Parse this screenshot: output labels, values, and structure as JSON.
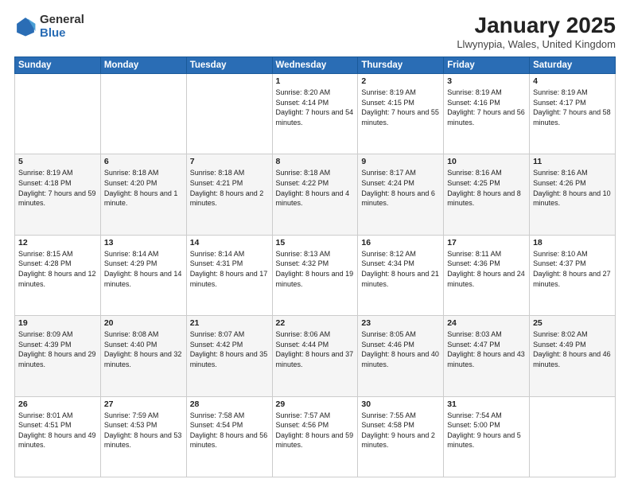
{
  "header": {
    "logo": {
      "general": "General",
      "blue": "Blue"
    },
    "title": "January 2025",
    "subtitle": "Llwynypia, Wales, United Kingdom"
  },
  "days_of_week": [
    "Sunday",
    "Monday",
    "Tuesday",
    "Wednesday",
    "Thursday",
    "Friday",
    "Saturday"
  ],
  "weeks": [
    [
      {
        "day": "",
        "sunrise": "",
        "sunset": "",
        "daylight": ""
      },
      {
        "day": "",
        "sunrise": "",
        "sunset": "",
        "daylight": ""
      },
      {
        "day": "",
        "sunrise": "",
        "sunset": "",
        "daylight": ""
      },
      {
        "day": "1",
        "sunrise": "Sunrise: 8:20 AM",
        "sunset": "Sunset: 4:14 PM",
        "daylight": "Daylight: 7 hours and 54 minutes."
      },
      {
        "day": "2",
        "sunrise": "Sunrise: 8:19 AM",
        "sunset": "Sunset: 4:15 PM",
        "daylight": "Daylight: 7 hours and 55 minutes."
      },
      {
        "day": "3",
        "sunrise": "Sunrise: 8:19 AM",
        "sunset": "Sunset: 4:16 PM",
        "daylight": "Daylight: 7 hours and 56 minutes."
      },
      {
        "day": "4",
        "sunrise": "Sunrise: 8:19 AM",
        "sunset": "Sunset: 4:17 PM",
        "daylight": "Daylight: 7 hours and 58 minutes."
      }
    ],
    [
      {
        "day": "5",
        "sunrise": "Sunrise: 8:19 AM",
        "sunset": "Sunset: 4:18 PM",
        "daylight": "Daylight: 7 hours and 59 minutes."
      },
      {
        "day": "6",
        "sunrise": "Sunrise: 8:18 AM",
        "sunset": "Sunset: 4:20 PM",
        "daylight": "Daylight: 8 hours and 1 minute."
      },
      {
        "day": "7",
        "sunrise": "Sunrise: 8:18 AM",
        "sunset": "Sunset: 4:21 PM",
        "daylight": "Daylight: 8 hours and 2 minutes."
      },
      {
        "day": "8",
        "sunrise": "Sunrise: 8:18 AM",
        "sunset": "Sunset: 4:22 PM",
        "daylight": "Daylight: 8 hours and 4 minutes."
      },
      {
        "day": "9",
        "sunrise": "Sunrise: 8:17 AM",
        "sunset": "Sunset: 4:24 PM",
        "daylight": "Daylight: 8 hours and 6 minutes."
      },
      {
        "day": "10",
        "sunrise": "Sunrise: 8:16 AM",
        "sunset": "Sunset: 4:25 PM",
        "daylight": "Daylight: 8 hours and 8 minutes."
      },
      {
        "day": "11",
        "sunrise": "Sunrise: 8:16 AM",
        "sunset": "Sunset: 4:26 PM",
        "daylight": "Daylight: 8 hours and 10 minutes."
      }
    ],
    [
      {
        "day": "12",
        "sunrise": "Sunrise: 8:15 AM",
        "sunset": "Sunset: 4:28 PM",
        "daylight": "Daylight: 8 hours and 12 minutes."
      },
      {
        "day": "13",
        "sunrise": "Sunrise: 8:14 AM",
        "sunset": "Sunset: 4:29 PM",
        "daylight": "Daylight: 8 hours and 14 minutes."
      },
      {
        "day": "14",
        "sunrise": "Sunrise: 8:14 AM",
        "sunset": "Sunset: 4:31 PM",
        "daylight": "Daylight: 8 hours and 17 minutes."
      },
      {
        "day": "15",
        "sunrise": "Sunrise: 8:13 AM",
        "sunset": "Sunset: 4:32 PM",
        "daylight": "Daylight: 8 hours and 19 minutes."
      },
      {
        "day": "16",
        "sunrise": "Sunrise: 8:12 AM",
        "sunset": "Sunset: 4:34 PM",
        "daylight": "Daylight: 8 hours and 21 minutes."
      },
      {
        "day": "17",
        "sunrise": "Sunrise: 8:11 AM",
        "sunset": "Sunset: 4:36 PM",
        "daylight": "Daylight: 8 hours and 24 minutes."
      },
      {
        "day": "18",
        "sunrise": "Sunrise: 8:10 AM",
        "sunset": "Sunset: 4:37 PM",
        "daylight": "Daylight: 8 hours and 27 minutes."
      }
    ],
    [
      {
        "day": "19",
        "sunrise": "Sunrise: 8:09 AM",
        "sunset": "Sunset: 4:39 PM",
        "daylight": "Daylight: 8 hours and 29 minutes."
      },
      {
        "day": "20",
        "sunrise": "Sunrise: 8:08 AM",
        "sunset": "Sunset: 4:40 PM",
        "daylight": "Daylight: 8 hours and 32 minutes."
      },
      {
        "day": "21",
        "sunrise": "Sunrise: 8:07 AM",
        "sunset": "Sunset: 4:42 PM",
        "daylight": "Daylight: 8 hours and 35 minutes."
      },
      {
        "day": "22",
        "sunrise": "Sunrise: 8:06 AM",
        "sunset": "Sunset: 4:44 PM",
        "daylight": "Daylight: 8 hours and 37 minutes."
      },
      {
        "day": "23",
        "sunrise": "Sunrise: 8:05 AM",
        "sunset": "Sunset: 4:46 PM",
        "daylight": "Daylight: 8 hours and 40 minutes."
      },
      {
        "day": "24",
        "sunrise": "Sunrise: 8:03 AM",
        "sunset": "Sunset: 4:47 PM",
        "daylight": "Daylight: 8 hours and 43 minutes."
      },
      {
        "day": "25",
        "sunrise": "Sunrise: 8:02 AM",
        "sunset": "Sunset: 4:49 PM",
        "daylight": "Daylight: 8 hours and 46 minutes."
      }
    ],
    [
      {
        "day": "26",
        "sunrise": "Sunrise: 8:01 AM",
        "sunset": "Sunset: 4:51 PM",
        "daylight": "Daylight: 8 hours and 49 minutes."
      },
      {
        "day": "27",
        "sunrise": "Sunrise: 7:59 AM",
        "sunset": "Sunset: 4:53 PM",
        "daylight": "Daylight: 8 hours and 53 minutes."
      },
      {
        "day": "28",
        "sunrise": "Sunrise: 7:58 AM",
        "sunset": "Sunset: 4:54 PM",
        "daylight": "Daylight: 8 hours and 56 minutes."
      },
      {
        "day": "29",
        "sunrise": "Sunrise: 7:57 AM",
        "sunset": "Sunset: 4:56 PM",
        "daylight": "Daylight: 8 hours and 59 minutes."
      },
      {
        "day": "30",
        "sunrise": "Sunrise: 7:55 AM",
        "sunset": "Sunset: 4:58 PM",
        "daylight": "Daylight: 9 hours and 2 minutes."
      },
      {
        "day": "31",
        "sunrise": "Sunrise: 7:54 AM",
        "sunset": "Sunset: 5:00 PM",
        "daylight": "Daylight: 9 hours and 5 minutes."
      },
      {
        "day": "",
        "sunrise": "",
        "sunset": "",
        "daylight": ""
      }
    ]
  ]
}
